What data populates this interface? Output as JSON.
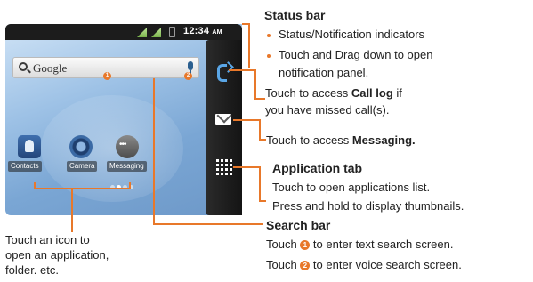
{
  "phone": {
    "status_time": "12:34",
    "status_ampm": "AM",
    "search_label": "Google",
    "badge_1": "1",
    "badge_2": "2",
    "apps": [
      {
        "label": "Contacts",
        "icon": "contacts-icon"
      },
      {
        "label": "Camera",
        "icon": "camera-icon"
      },
      {
        "label": "Messaging",
        "icon": "messaging-icon"
      }
    ],
    "dock_icons": [
      "phone-call-log-icon",
      "envelope-messaging-icon",
      "app-grid-icon"
    ],
    "page_indicator_count": 4,
    "page_indicator_active": 1
  },
  "annotations": {
    "status_bar": {
      "title": "Status bar",
      "bullet_1": "Status/Notification indicators",
      "bullet_2_line1": "Touch and Drag down to open",
      "bullet_2_line2": "notification panel."
    },
    "call_log": {
      "line1_prefix": "Touch to access ",
      "line1_bold": "Call log",
      "line1_suffix": " if",
      "line2": "you have missed call(s)."
    },
    "messaging": {
      "prefix": "Touch to access ",
      "bold": "Messaging."
    },
    "application_tab": {
      "title": "Application tab",
      "line1": "Touch to open applications list.",
      "line2": "Press and hold to display thumbnails."
    },
    "search_bar": {
      "title": "Search bar",
      "line1_prefix": "Touch ",
      "line1_suffix": " to enter text search screen.",
      "line2_prefix": "Touch ",
      "line2_suffix": " to enter voice search screen."
    },
    "icons": {
      "line1": "Touch an icon to",
      "line2": "open an application,",
      "line3": "folder. etc."
    }
  },
  "colors": {
    "accent_orange": "#e8782a",
    "dock_dark": "#1c1c1c",
    "wallpaper_blue": "#7aa6d4"
  }
}
